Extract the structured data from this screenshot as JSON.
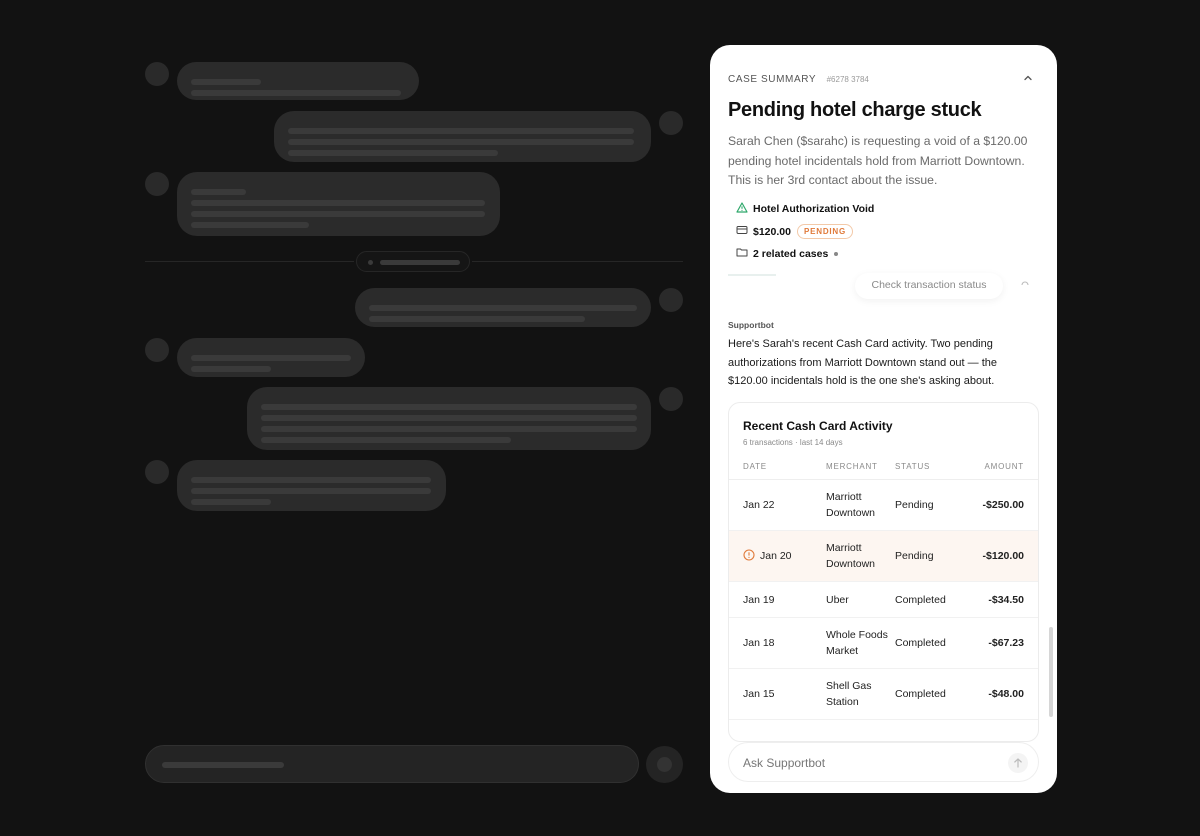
{
  "panel": {
    "eyebrow": "CASE SUMMARY",
    "case_id": "#6278 3784",
    "title": "Pending hotel charge stuck",
    "summary": "Sarah Chen ($sarahc) is requesting a void of a $120.00 pending hotel incidentals hold from Marriott Downtown. This is her 3rd contact about the issue.",
    "meta": {
      "type_label": "Hotel Authorization Void",
      "amount": "$120.00",
      "status_badge": "PENDING",
      "related": "2 related cases"
    },
    "tool_chip": "Check transaction status",
    "bot_name": "Supportbot",
    "bot_message": "Here's Sarah's recent Cash Card activity. Two pending authorizations from Marriott Downtown stand out — the $120.00 incidentals hold is the one she's asking about.",
    "card": {
      "title": "Recent Cash Card Activity",
      "subtitle": "6 transactions · last 14 days",
      "columns": [
        "DATE",
        "MERCHANT",
        "STATUS",
        "AMOUNT"
      ],
      "rows": [
        {
          "date": "Jan 22",
          "merchant": "Marriott Downtown",
          "status": "Pending",
          "amount": "-$250.00",
          "flagged": false
        },
        {
          "date": "Jan 20",
          "merchant": "Marriott Downtown",
          "status": "Pending",
          "amount": "-$120.00",
          "flagged": true
        },
        {
          "date": "Jan 19",
          "merchant": "Uber",
          "status": "Completed",
          "amount": "-$34.50",
          "flagged": false
        },
        {
          "date": "Jan 18",
          "merchant": "Whole Foods Market",
          "status": "Completed",
          "amount": "-$67.23",
          "flagged": false
        },
        {
          "date": "Jan 15",
          "merchant": "Shell Gas Station",
          "status": "Completed",
          "amount": "-$48.00",
          "flagged": false
        }
      ]
    },
    "ask_placeholder": "Ask Supportbot"
  },
  "colors": {
    "background": "#121212",
    "accent_warning": "#e07a3a",
    "success_icon": "#2fa86b",
    "flag_row": "#fdf6f1"
  },
  "icons": [
    "chevron-up-icon",
    "warning-triangle-icon",
    "card-icon",
    "folder-icon",
    "spinner-icon",
    "alert-circle-icon",
    "arrow-up-icon"
  ]
}
